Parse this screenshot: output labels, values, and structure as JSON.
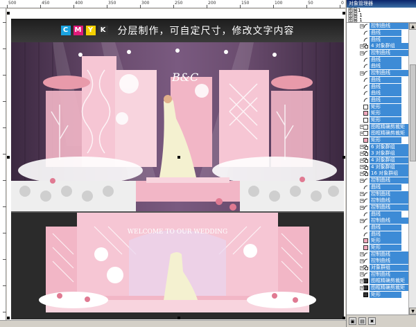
{
  "ruler": {
    "top_labels": [
      "500",
      "450",
      "400",
      "350",
      "300",
      "250",
      "200",
      "150",
      "100",
      "50",
      "0"
    ],
    "left_labels": [
      "50",
      "100",
      "150",
      "200",
      "250",
      "300",
      "350",
      "400",
      "450",
      "500",
      "550",
      "600"
    ]
  },
  "banner": {
    "cmyk": [
      {
        "letter": "C",
        "color": "#1aa3e0"
      },
      {
        "letter": "M",
        "color": "#e0197a"
      },
      {
        "letter": "Y",
        "color": "#f4d000"
      },
      {
        "letter": "K",
        "color": "#333333"
      }
    ],
    "text": "分层制作，可自定尺寸，修改文字内容"
  },
  "stage": {
    "lower_sign_text": "WELCOME TO OUR WEDDING",
    "upper_initials": "B&C",
    "colors": {
      "pink": "#f2b6c6",
      "light_pink": "#f8d4de",
      "purple": "#5a3a5c",
      "white": "#ffffff",
      "dress": "#f4f1d0"
    }
  },
  "panel": {
    "title": "对象管理器",
    "head_lines": [
      "图层1",
      "图层 1",
      "图层 1"
    ],
    "items": [
      {
        "label": "控制曲线",
        "icon": "curve-icon",
        "expand": true,
        "selected": true
      },
      {
        "label": "曲线",
        "icon": "curve-icon",
        "expand": false,
        "selected": true
      },
      {
        "label": "曲线",
        "icon": "curve-icon",
        "expand": false,
        "selected": true
      },
      {
        "label": "4 对象群组",
        "icon": "group-icon",
        "expand": true,
        "selected": true
      },
      {
        "label": "控制曲线",
        "icon": "curve-icon",
        "expand": true,
        "selected": true
      },
      {
        "label": "曲线",
        "icon": "curve-icon",
        "expand": false,
        "selected": true
      },
      {
        "label": "曲线",
        "icon": "curve-icon",
        "expand": false,
        "selected": true
      },
      {
        "label": "控制曲线",
        "icon": "curve-icon",
        "expand": true,
        "selected": true
      },
      {
        "label": "曲线",
        "icon": "curve-icon",
        "expand": false,
        "selected": true
      },
      {
        "label": "曲线",
        "icon": "curve-icon",
        "expand": false,
        "selected": true
      },
      {
        "label": "曲线",
        "icon": "curve-icon",
        "expand": false,
        "selected": true
      },
      {
        "label": "曲线",
        "icon": "curve-icon",
        "expand": false,
        "selected": true
      },
      {
        "label": "矩形",
        "icon": "rect-icon",
        "expand": false,
        "selected": true
      },
      {
        "label": "矩形",
        "icon": "rect-pink-icon",
        "expand": false,
        "selected": true
      },
      {
        "label": "矩形",
        "icon": "rect-icon",
        "expand": false,
        "selected": true
      },
      {
        "label": "图框精确剪裁矩",
        "icon": "rect-icon",
        "expand": true,
        "selected": true
      },
      {
        "label": "图框精确剪裁矩",
        "icon": "rect-icon",
        "expand": true,
        "selected": true
      },
      {
        "label": "矩形",
        "icon": "rect-pink-icon",
        "expand": false,
        "selected": true
      },
      {
        "label": "6 对象群组",
        "icon": "group-icon",
        "expand": true,
        "selected": true
      },
      {
        "label": "3 对象群组",
        "icon": "group-icon",
        "expand": true,
        "selected": true
      },
      {
        "label": "4 对象群组",
        "icon": "group-icon",
        "expand": true,
        "selected": true
      },
      {
        "label": "4 对象群组",
        "icon": "group-icon",
        "expand": true,
        "selected": true
      },
      {
        "label": "16 对象群组",
        "icon": "group-icon",
        "expand": true,
        "selected": true
      },
      {
        "label": "控制曲线",
        "icon": "curve-icon",
        "expand": true,
        "selected": true
      },
      {
        "label": "曲线",
        "icon": "curve-icon",
        "expand": false,
        "selected": true
      },
      {
        "label": "控制曲线",
        "icon": "curve-icon",
        "expand": true,
        "selected": true
      },
      {
        "label": "控制曲线",
        "icon": "curve-icon",
        "expand": true,
        "selected": true
      },
      {
        "label": "控制曲线",
        "icon": "curve-icon",
        "expand": true,
        "selected": true
      },
      {
        "label": "曲线",
        "icon": "curve-icon",
        "expand": false,
        "selected": true
      },
      {
        "label": "控制曲线",
        "icon": "curve-icon",
        "expand": true,
        "selected": true
      },
      {
        "label": "曲线",
        "icon": "curve-icon",
        "expand": false,
        "selected": true
      },
      {
        "label": "曲线",
        "icon": "curve-icon",
        "expand": false,
        "selected": true
      },
      {
        "label": "矩形",
        "icon": "rect-pink-icon",
        "expand": false,
        "selected": true
      },
      {
        "label": "矩形",
        "icon": "rect-pink-icon",
        "expand": false,
        "selected": true
      },
      {
        "label": "控制曲线",
        "icon": "curve-icon",
        "expand": true,
        "selected": true
      },
      {
        "label": "控制曲线",
        "icon": "curve-icon",
        "expand": true,
        "selected": true
      },
      {
        "label": "对象群组",
        "icon": "group-icon",
        "expand": true,
        "selected": true
      },
      {
        "label": "控制曲线",
        "icon": "curve-icon",
        "expand": true,
        "selected": true
      },
      {
        "label": "图框精确剪裁矩",
        "icon": "rect-dark-icon",
        "expand": true,
        "selected": true
      },
      {
        "label": "图框精确剪裁矩",
        "icon": "rect-dark-icon",
        "expand": true,
        "selected": true
      },
      {
        "label": "矩形",
        "icon": "rect-dark-icon",
        "expand": false,
        "selected": true
      }
    ]
  }
}
